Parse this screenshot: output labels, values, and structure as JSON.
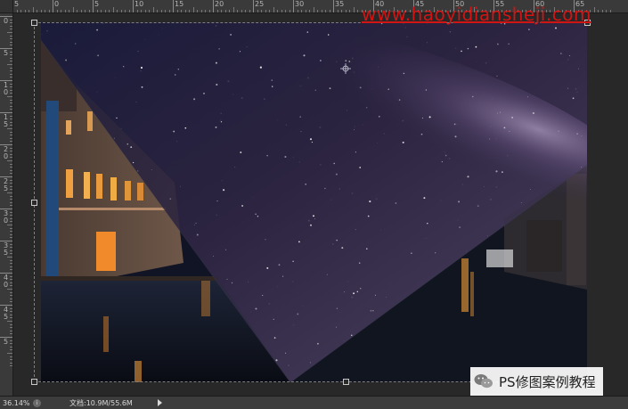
{
  "rulers": {
    "top_labels": [
      "5",
      "0",
      "5",
      "10",
      "15",
      "20",
      "25",
      "30",
      "35",
      "40",
      "45",
      "50",
      "55",
      "60",
      "65"
    ],
    "left_labels": [
      "0",
      "5",
      "1\n0",
      "1\n5",
      "2\n0",
      "2\n5",
      "3\n0",
      "3\n5",
      "4\n0",
      "4\n5",
      "5"
    ]
  },
  "watermark": {
    "url": "www.haoyidiansheji.com"
  },
  "wechat": {
    "label": "PS修图案例教程",
    "icon": "wechat-icon"
  },
  "statusbar": {
    "zoom": "36.14%",
    "doc_info": "文档:10.9M/55.6M",
    "info_icon": "info-icon",
    "menu_arrow_icon": "triangle-right-icon"
  },
  "colors": {
    "workspace": "#282828",
    "ruler": "#3a3a3a",
    "watermark_red": "#d21414"
  }
}
